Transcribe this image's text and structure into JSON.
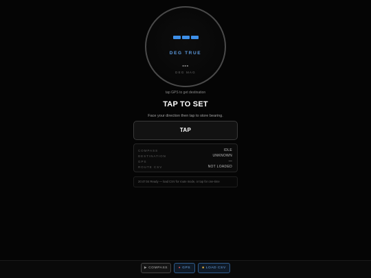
{
  "compass": {
    "deg_true_label": "DEG TRUE",
    "deg_mag_value": "---",
    "deg_mag_label": "DEG MAG",
    "accent": "#3d8fe8"
  },
  "hint": "tap GPS to get destination",
  "heading": "TAP TO SET",
  "subtext": "Face your direction then tap to store bearing.",
  "tap_button": "TAP",
  "status": [
    {
      "key": "COMPASS",
      "value": "IDLE"
    },
    {
      "key": "DESTINATION",
      "value": "UNKNOWN"
    },
    {
      "key": "GPS",
      "value": "—"
    },
    {
      "key": "ROUTE CSV",
      "value": "NOT LOADED"
    }
  ],
  "log": "20:47:04 Ready — load CSV for route mode, or tap for one-time",
  "bottom_bar": {
    "compass": {
      "icon": "play-icon",
      "label": "COMPASS"
    },
    "gps": {
      "icon": "pin-icon",
      "label": "GPS"
    },
    "load_csv": {
      "icon": "folder-icon",
      "label": "LOAD CSV"
    }
  }
}
